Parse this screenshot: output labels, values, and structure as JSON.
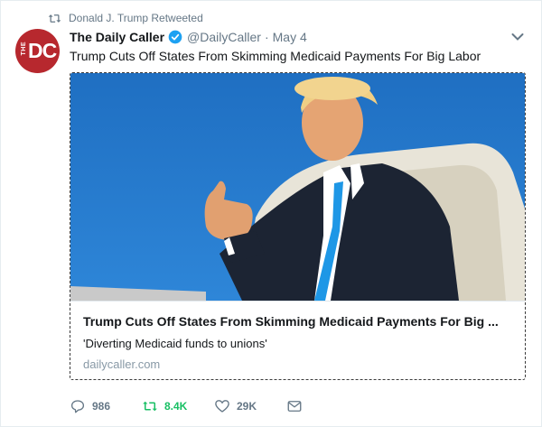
{
  "retweet_context": {
    "text": "Donald J. Trump Retweeted",
    "icon": "retweet-icon"
  },
  "author": {
    "name": "The Daily Caller",
    "handle": "@DailyCaller",
    "separator": "·",
    "time": "May 4",
    "verified": true,
    "avatar_label_small": "THE",
    "avatar_label_large": "DC",
    "avatar_color": "#b7282e"
  },
  "tweet": {
    "text": "Trump Cuts Off States From Skimming Medicaid Payments For Big Labor"
  },
  "card": {
    "title": "Trump Cuts Off States From Skimming Medicaid Payments For Big ...",
    "description": "'Diverting Medicaid funds to unions'",
    "domain": "dailycaller.com"
  },
  "actions": {
    "reply_count": "986",
    "retweet_count": "8.4K",
    "like_count": "29K"
  },
  "colors": {
    "retweet_active": "#17bf63",
    "verified": "#1da1f2",
    "secondary_text": "#657786"
  }
}
